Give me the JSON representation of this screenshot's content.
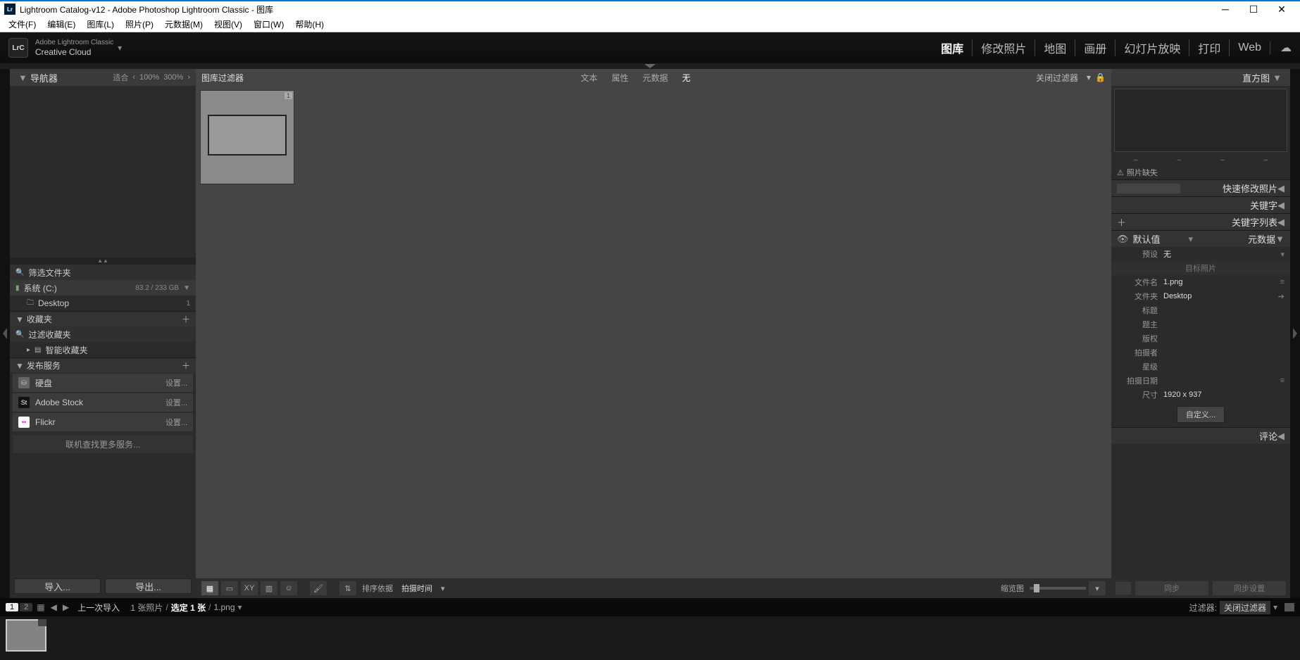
{
  "window": {
    "title": "Lightroom Catalog-v12 - Adobe Photoshop Lightroom Classic - 图库"
  },
  "menu": {
    "file": "文件(F)",
    "edit": "编辑(E)",
    "library": "图库(L)",
    "photo": "照片(P)",
    "metadata": "元数据(M)",
    "view": "视图(V)",
    "window": "窗口(W)",
    "help": "帮助(H)"
  },
  "brand": {
    "line1": "Adobe Lightroom Classic",
    "line2": "Creative Cloud"
  },
  "modules": {
    "library": "图库",
    "develop": "修改照片",
    "map": "地图",
    "book": "画册",
    "slideshow": "幻灯片放映",
    "print": "打印",
    "web": "Web"
  },
  "leftpanel": {
    "navigator": {
      "title": "导航器",
      "fit": "适合",
      "z100": "100%",
      "z300": "300%"
    },
    "filterFolders": "筛选文件夹",
    "drive": {
      "name": "系统 (C:)",
      "usage": "83.2 / 233 GB"
    },
    "folder": {
      "name": "Desktop",
      "count": "1"
    },
    "collections": {
      "title": "收藏夹",
      "filter": "过滤收藏夹",
      "smart": "智能收藏夹"
    },
    "publish": {
      "title": "发布服务",
      "hdd": "硬盘",
      "stock": "Adobe Stock",
      "flickr": "Flickr",
      "setup": "设置...",
      "findMore": "联机查找更多服务..."
    },
    "importBtn": "导入...",
    "exportBtn": "导出..."
  },
  "filterbar": {
    "title": "图库过滤器",
    "text": "文本",
    "attribute": "属性",
    "metadata": "元数据",
    "none": "无",
    "close": "关闭过滤器"
  },
  "toolbar": {
    "sortLabel": "排序依据",
    "sortValue": "拍摄时间",
    "thumbLabel": "缩览图"
  },
  "rightpanel": {
    "histogram": "直方图",
    "photoMissing": "照片缺失",
    "quickDevelop": "快速修改照片",
    "keywords": "关键字",
    "keywordList": "关键字列表",
    "metadata": "元数据",
    "defaultSet": "默认值",
    "preset": {
      "label": "预设",
      "value": "无"
    },
    "targetPhoto": "目标照片",
    "fields": {
      "filename": {
        "label": "文件名",
        "value": "1.png"
      },
      "folder": {
        "label": "文件夹",
        "value": "Desktop"
      },
      "title": {
        "label": "标题",
        "value": ""
      },
      "caption": {
        "label": "题主",
        "value": ""
      },
      "copyright": {
        "label": "版权",
        "value": ""
      },
      "creator": {
        "label": "拍摄者",
        "value": ""
      },
      "rating": {
        "label": "星级",
        "value": ""
      },
      "date": {
        "label": "拍摄日期",
        "value": ""
      },
      "dim": {
        "label": "尺寸",
        "value": "1920 x 937"
      }
    },
    "customize": "自定义...",
    "comments": "评论",
    "sync": "同步",
    "syncSettings": "同步设置"
  },
  "status": {
    "one": "1",
    "two": "2",
    "lastImport": "上一次导入",
    "countPhotos": "1 张照片",
    "selected": "选定 1 张",
    "filename": "1.png",
    "filterLabel": "过滤器:",
    "filterValue": "关闭过滤器"
  }
}
